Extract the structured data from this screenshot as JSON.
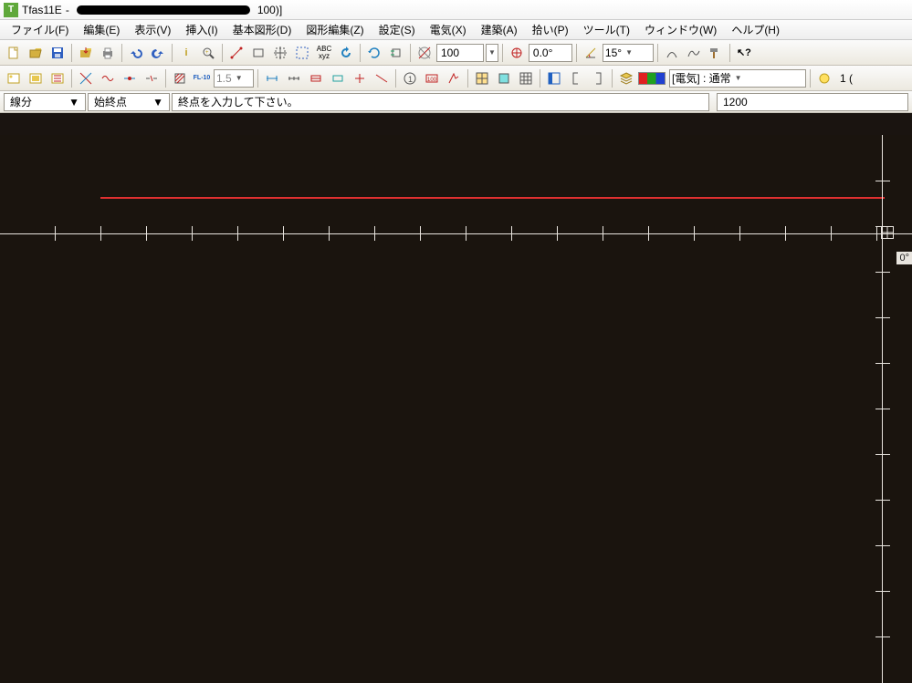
{
  "title": {
    "app": "Tfas11E",
    "suffix": "100)]",
    "icon_letter": "T"
  },
  "menu": [
    {
      "label": "ファイル(F)"
    },
    {
      "label": "編集(E)"
    },
    {
      "label": "表示(V)"
    },
    {
      "label": "挿入(I)"
    },
    {
      "label": "基本図形(D)"
    },
    {
      "label": "図形編集(Z)"
    },
    {
      "label": "設定(S)"
    },
    {
      "label": "電気(X)"
    },
    {
      "label": "建築(A)"
    },
    {
      "label": "拾い(P)"
    },
    {
      "label": "ツール(T)"
    },
    {
      "label": "ウィンドウ(W)"
    },
    {
      "label": "ヘルプ(H)"
    }
  ],
  "toolbar1": {
    "zoom": "100",
    "angle": "0.0°",
    "snap_angle": "15°"
  },
  "toolbar2": {
    "line_width": "1.5",
    "layer_label": "[電気] : 通常",
    "right_val": "1 ("
  },
  "cmd": {
    "mode": "線分",
    "snap": "始終点",
    "prompt": "終点を入力して下さい。",
    "value": "1200"
  },
  "canvas": {
    "angle_label": "0°"
  }
}
